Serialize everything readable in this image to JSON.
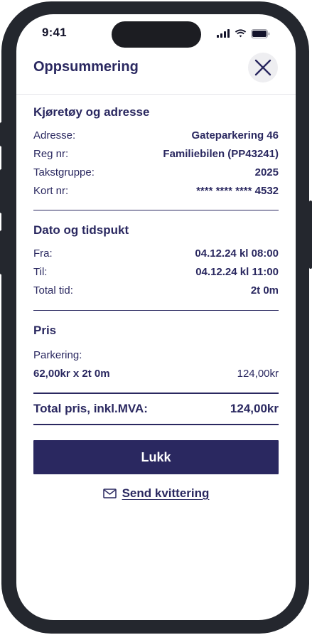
{
  "status_bar": {
    "time": "9:41"
  },
  "header": {
    "title": "Oppsummering"
  },
  "vehicle": {
    "title": "Kjøretøy og adresse",
    "rows": [
      {
        "label": "Adresse:",
        "value": "Gateparkering 46"
      },
      {
        "label": "Reg nr:",
        "value": "Familiebilen (PP43241)"
      },
      {
        "label": "Takstgruppe:",
        "value": "2025"
      },
      {
        "label": "Kort nr:",
        "value": "**** **** **** 4532"
      }
    ]
  },
  "datetime": {
    "title": "Dato og tidspukt",
    "rows": [
      {
        "label": "Fra:",
        "value": "04.12.24 kl 08:00"
      },
      {
        "label": "Til:",
        "value": "04.12.24 kl 11:00"
      },
      {
        "label": "Total tid:",
        "value": "2t 0m"
      }
    ]
  },
  "price": {
    "title": "Pris",
    "item_label": "Parkering:",
    "item_detail": "62,00kr x 2t 0m",
    "item_amount": "124,00kr",
    "total_label": "Total pris, inkl.MVA:",
    "total_value": "124,00kr"
  },
  "actions": {
    "close_label": "Lukk",
    "send_receipt_label": "Send kvittering"
  },
  "colors": {
    "primary": "#2a2860",
    "frame": "#24272e"
  }
}
